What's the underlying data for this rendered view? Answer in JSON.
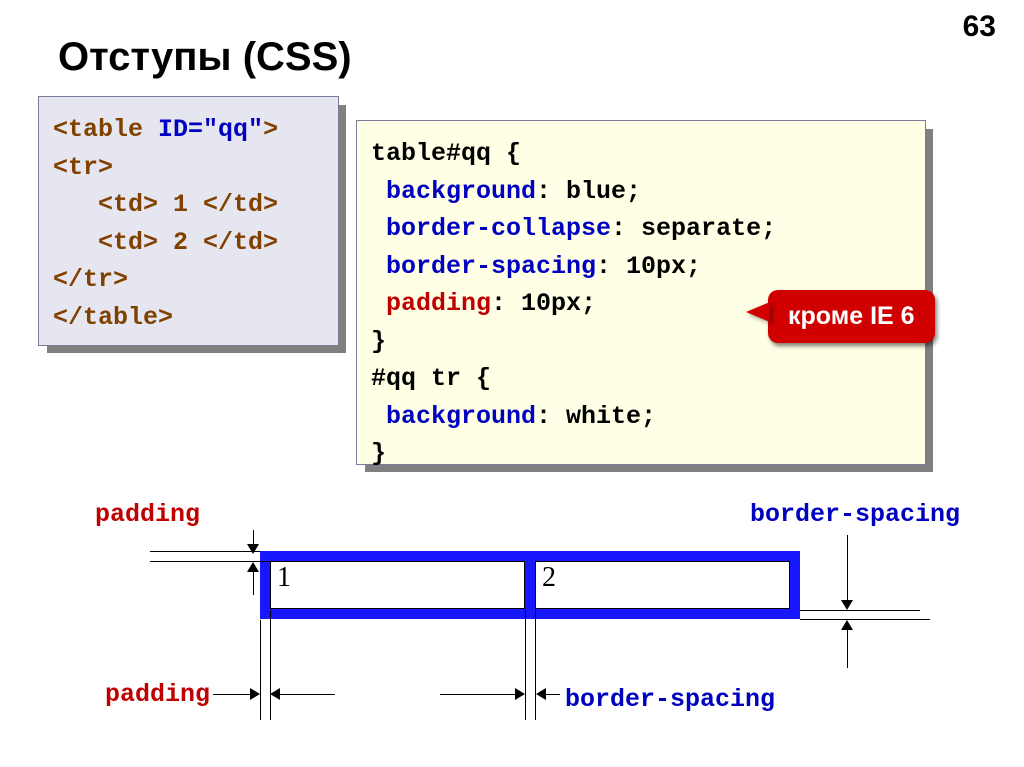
{
  "page_number": "63",
  "title": "Отступы (CSS)",
  "left_code": {
    "l1a": "<table ",
    "l1b": "ID=\"qq\"",
    "l1c": ">",
    "l2": "<tr>",
    "l3": "   <td> 1 </td>",
    "l4": "   <td> 2 </td>",
    "l5": "</tr>",
    "l6": "</table>"
  },
  "right_code": {
    "r1": "table#qq {",
    "r2a": " background",
    "r2b": ": blue;",
    "r3a": " border-collapse",
    "r3b": ": separate;",
    "r4a": " border-spacing",
    "r4b": ": 10px; ",
    "r5a": " padding",
    "r5b": ": 10px;",
    "r6": "}",
    "r7": "#qq tr {",
    "r8a": " background",
    "r8b": ": white;",
    "r9": "}"
  },
  "callout": "кроме IE 6",
  "diagram": {
    "padding_lbl_top": "padding",
    "padding_lbl_bot": "padding",
    "border_spacing_lbl_top": "border-spacing",
    "border_spacing_lbl_bot": "border-spacing",
    "cell1": "1",
    "cell2": "2"
  }
}
